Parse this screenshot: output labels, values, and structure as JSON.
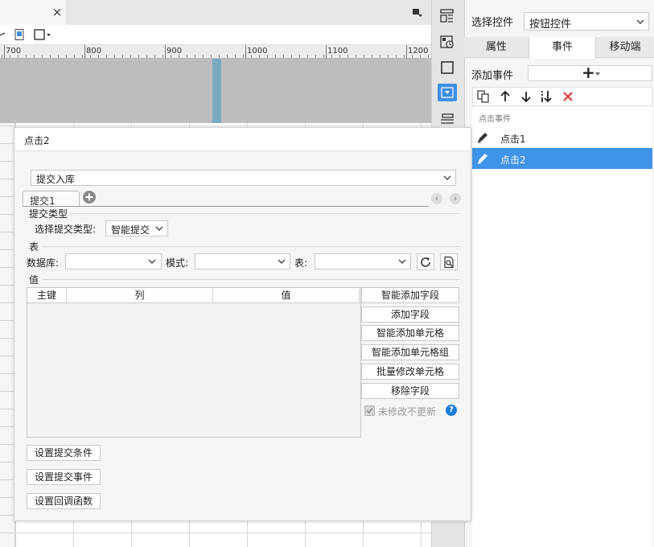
{
  "editor": {
    "tab_close": "×",
    "ruler_labels": [
      "700",
      "800",
      "900",
      "1000",
      "1100",
      "1200"
    ]
  },
  "right_panel": {
    "select_widget_label": "选择控件",
    "widget_select_value": "按钮控件",
    "tabs": [
      {
        "label": "属性",
        "active": false
      },
      {
        "label": "事件",
        "active": true
      },
      {
        "label": "移动端",
        "active": false
      }
    ],
    "add_event_label": "添加事件",
    "add_event_symbol": "+",
    "event_group_label": "点击事件",
    "events": [
      {
        "label": "点击1",
        "selected": false
      },
      {
        "label": "点击2",
        "selected": true
      }
    ]
  },
  "dialog": {
    "title": "点击2",
    "submit_select_value": "提交入库",
    "subtab_label": "提交1",
    "submit_type_section": "提交类型",
    "submit_type_field_label": "选择提交类型:",
    "submit_type_value": "智能提交",
    "table_section": "表",
    "database_label": "数据库:",
    "mode_label": "模式:",
    "table_label": "表:",
    "value_section": "值",
    "columns": [
      "主键",
      "列",
      "值"
    ],
    "side_buttons": [
      "智能添加字段",
      "添加字段",
      "智能添加单元格",
      "智能添加单元格组",
      "批量修改单元格",
      "移除字段"
    ],
    "no_update_label": "未修改不更新",
    "no_update_checked": true,
    "help_symbol": "?",
    "bottom_buttons": [
      "设置提交条件",
      "设置提交事件",
      "设置回调函数"
    ]
  },
  "colors": {
    "accent": "#3f93e8",
    "delete_red": "#e23b3b",
    "help_blue": "#1a7ddd",
    "canvas_guide": "#7aa9bf"
  }
}
